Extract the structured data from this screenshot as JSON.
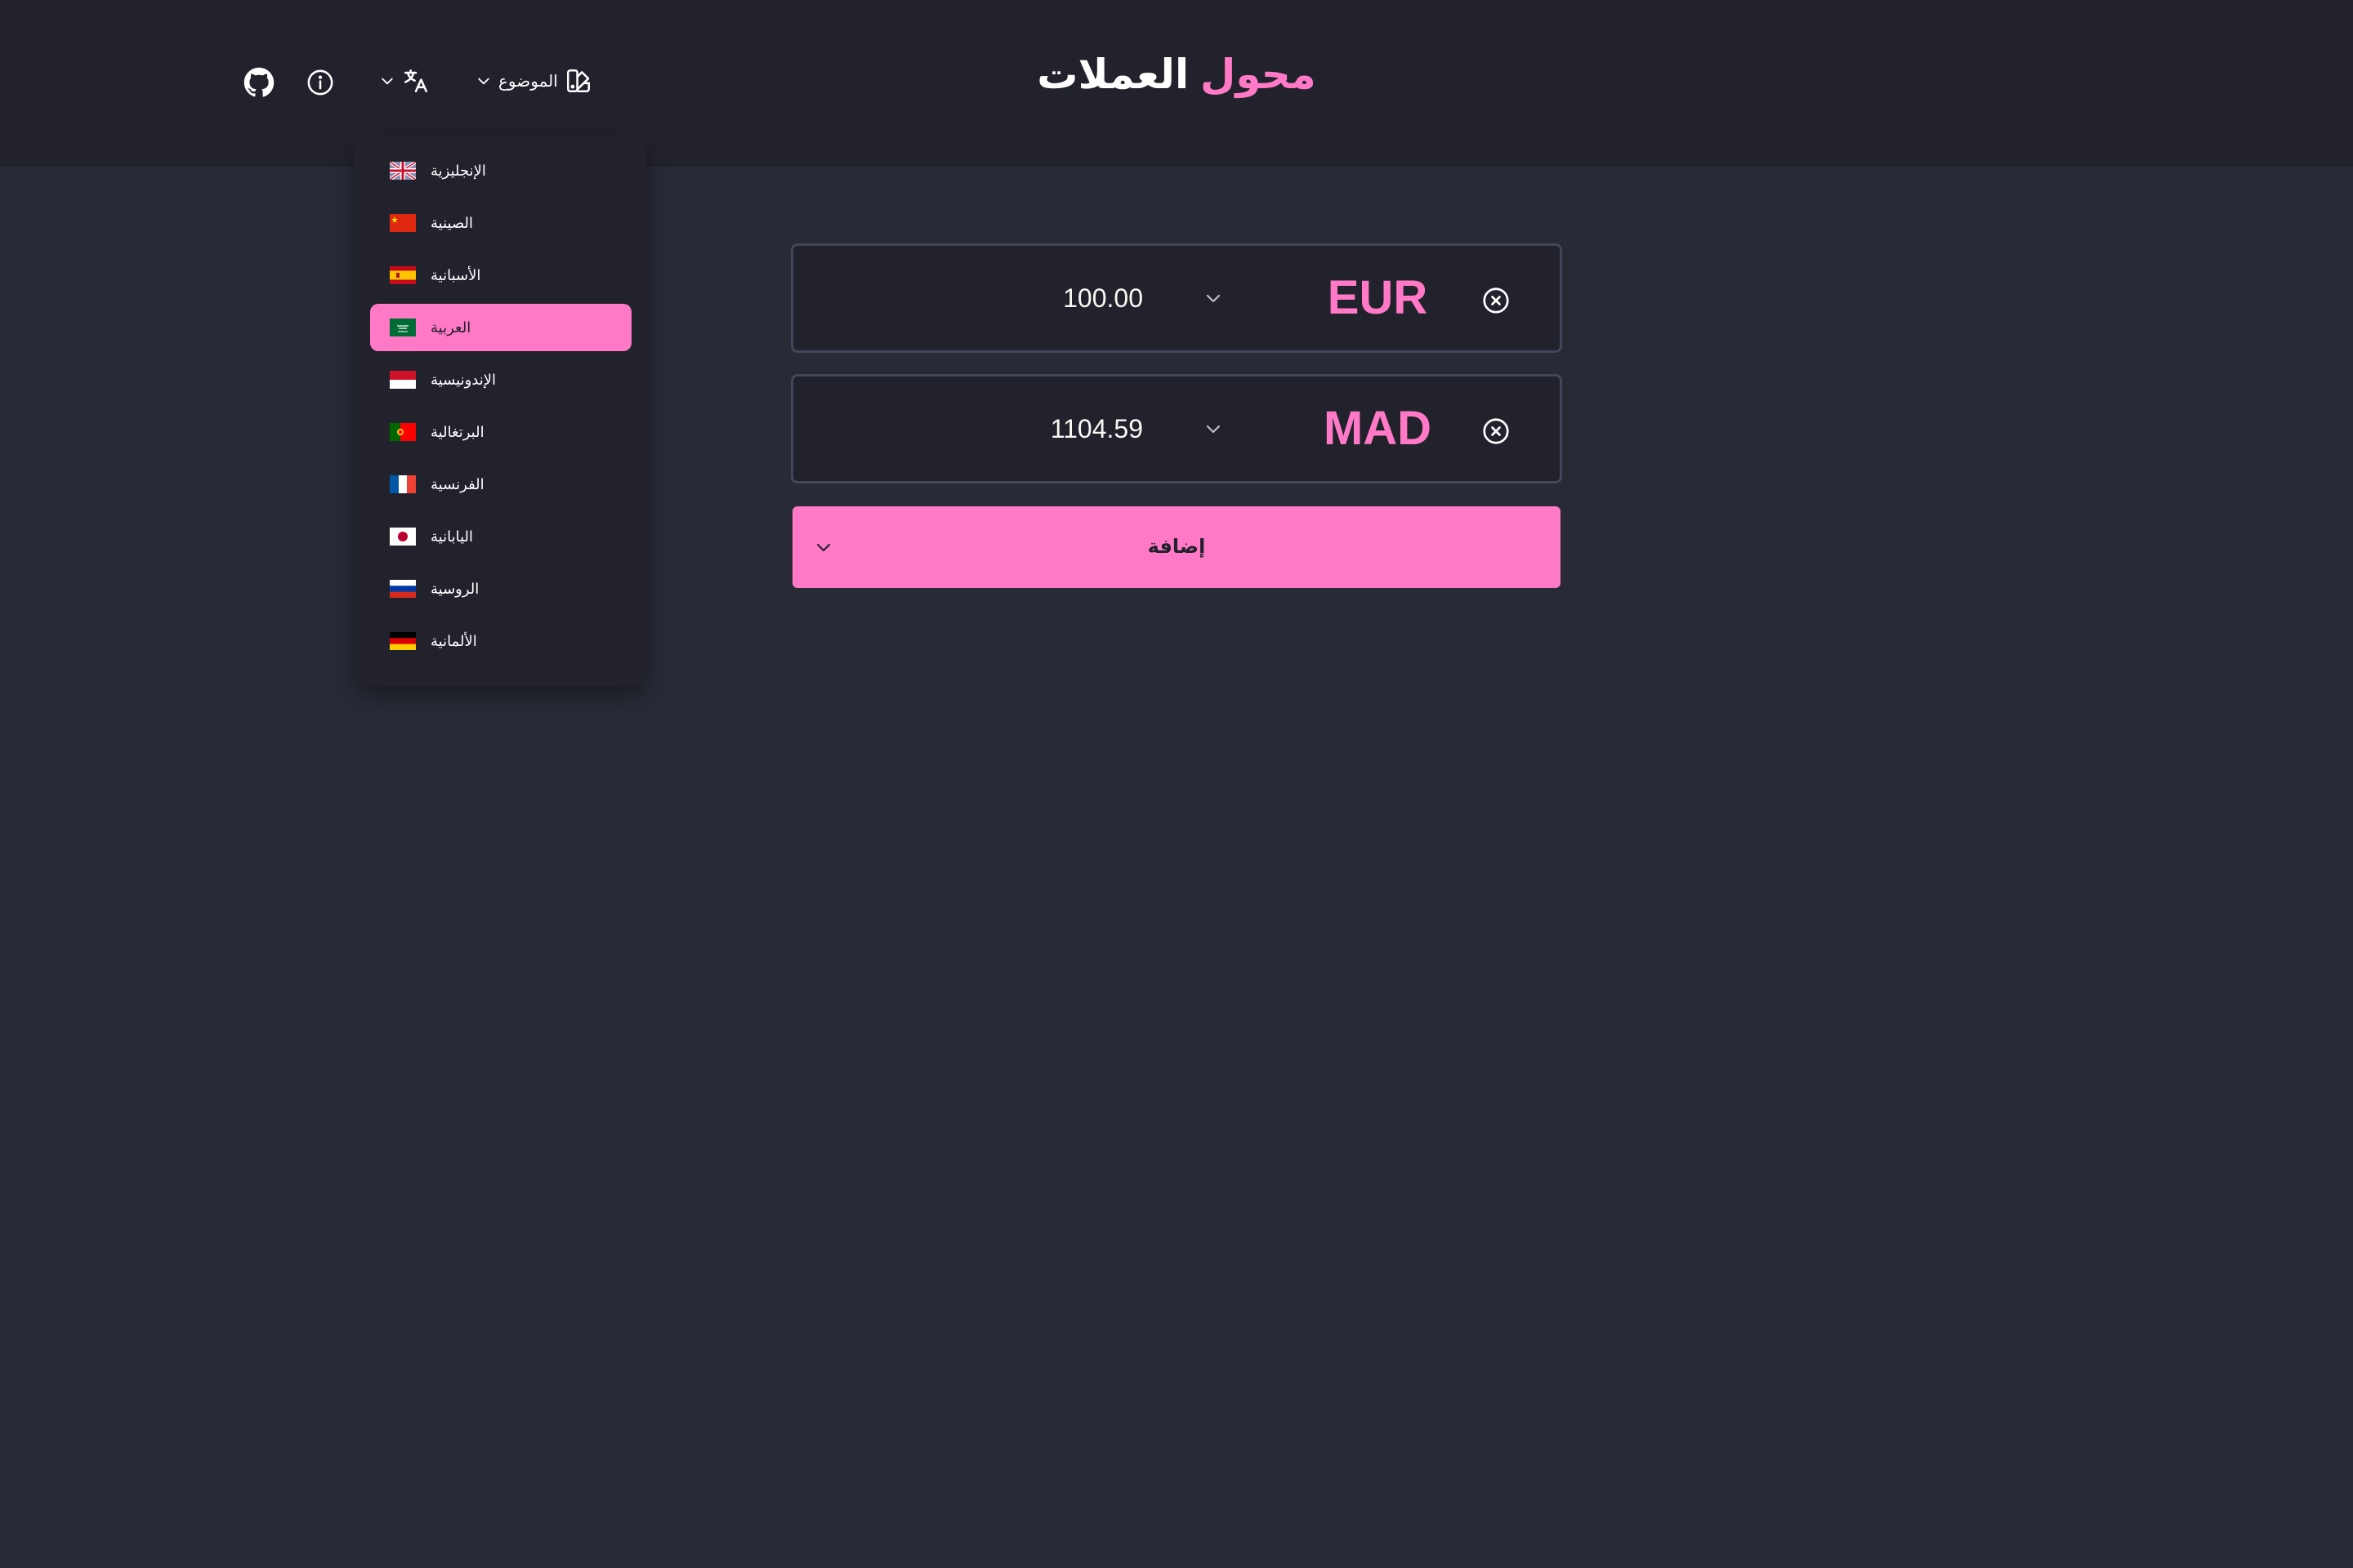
{
  "app": {
    "title_accent": "محول",
    "title_rest": "العملات"
  },
  "header": {
    "theme_label": "الموضوع",
    "icons": [
      "github-icon",
      "info-icon",
      "translate-icon",
      "chevron-down-icon",
      "palette-icon"
    ]
  },
  "language_menu": {
    "items": [
      {
        "label": "الإنجليزية",
        "flag": "uk",
        "active": false
      },
      {
        "label": "الصينية",
        "flag": "cn",
        "active": false
      },
      {
        "label": "الأسبانية",
        "flag": "es",
        "active": false
      },
      {
        "label": "العربية",
        "flag": "sa",
        "active": true
      },
      {
        "label": "الإندونيسية",
        "flag": "id",
        "active": false
      },
      {
        "label": "البرتغالية",
        "flag": "pt",
        "active": false
      },
      {
        "label": "الفرنسية",
        "flag": "fr",
        "active": false
      },
      {
        "label": "اليابانية",
        "flag": "jp",
        "active": false
      },
      {
        "label": "الروسية",
        "flag": "ru",
        "active": false
      },
      {
        "label": "الألمانية",
        "flag": "de",
        "active": false
      }
    ]
  },
  "converter": {
    "rows": [
      {
        "amount": "100.00",
        "currency": "EUR"
      },
      {
        "amount": "1104.59",
        "currency": "MAD"
      }
    ],
    "add_label": "إضافة"
  },
  "colors": {
    "accent": "#ff79c6",
    "background": "#282a36",
    "header_bg": "#21222c",
    "border": "#44475a"
  }
}
